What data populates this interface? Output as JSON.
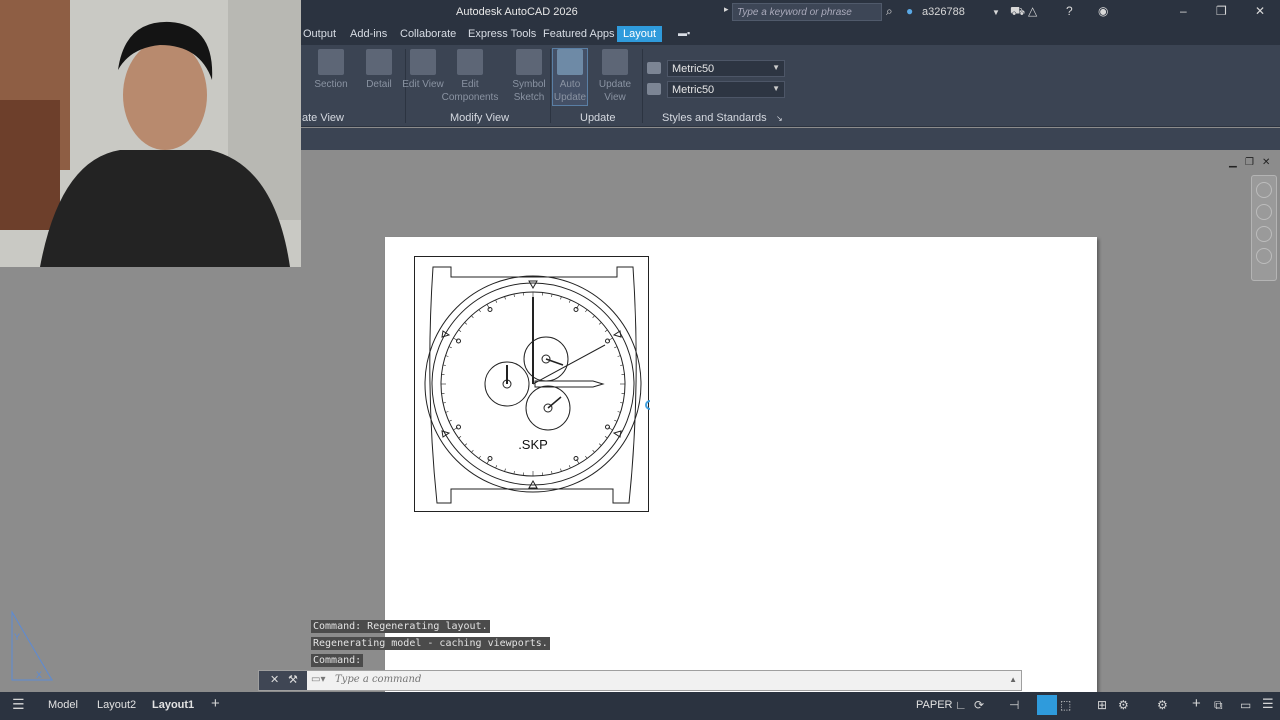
{
  "app": {
    "title": "Autodesk AutoCAD 2026"
  },
  "search": {
    "placeholder": "Type a keyword or phrase"
  },
  "user": {
    "name": "a326788"
  },
  "ribbon_tabs": [
    {
      "label": "Output"
    },
    {
      "label": "Add-ins"
    },
    {
      "label": "Collaborate"
    },
    {
      "label": "Express Tools"
    },
    {
      "label": "Featured Apps"
    },
    {
      "label": "Layout"
    }
  ],
  "ribbon": {
    "buttons": {
      "section": "Section",
      "detail": "Detail",
      "edit_view": "Edit View",
      "edit_components": "Edit Components",
      "symbol_sketch": "Symbol Sketch",
      "auto_update": "Auto Update",
      "update_view": "Update View"
    },
    "styles": {
      "dropdown1": "Metric50",
      "dropdown2": "Metric50"
    },
    "panels": {
      "create_view": "ate View",
      "modify_view": "Modify View",
      "update": "Update",
      "styles": "Styles and Standards"
    }
  },
  "drawing": {
    "label": ".SKP"
  },
  "command_line": {
    "history": [
      "Command: Regenerating layout.",
      "Regenerating model - caching viewports.",
      "Command:"
    ],
    "placeholder": "Type a command"
  },
  "status_bar": {
    "tabs": [
      {
        "label": "Model"
      },
      {
        "label": "Layout2"
      },
      {
        "label": "Layout1"
      }
    ],
    "space": "PAPER"
  },
  "colors": {
    "accent": "#2f9bdc",
    "ribbon_bg": "#3b4453",
    "title_bg": "#2b3340"
  }
}
